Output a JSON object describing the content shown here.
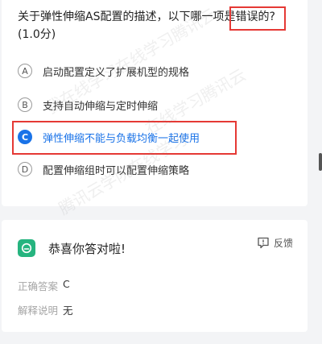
{
  "question": {
    "text": "关于弹性伸缩AS配置的描述，以下哪一项是错误的?(1.0分)",
    "options": [
      {
        "letter": "A",
        "text": "启动配置定义了扩展机型的规格",
        "selected": false
      },
      {
        "letter": "B",
        "text": "支持自动伸缩与定时伸缩",
        "selected": false
      },
      {
        "letter": "C",
        "text": "弹性伸缩不能与负载均衡一起使用",
        "selected": true
      },
      {
        "letter": "D",
        "text": "配置伸缩组时可以配置伸缩策略",
        "selected": false
      }
    ]
  },
  "result": {
    "title": "恭喜你答对啦!",
    "feedback_label": "反馈",
    "correct_answer_label": "正确答案",
    "correct_answer_value": "C",
    "explanation_label": "解释说明",
    "explanation_value": "无"
  },
  "watermark": {
    "lines": [
      "我在线学习在线学习腾讯云",
      "在线学习腾讯云",
      "腾讯云学院在线学习"
    ]
  },
  "colors": {
    "accent": "#1a73e8",
    "highlight_border": "#e53935",
    "success_green": "#26b47f"
  }
}
